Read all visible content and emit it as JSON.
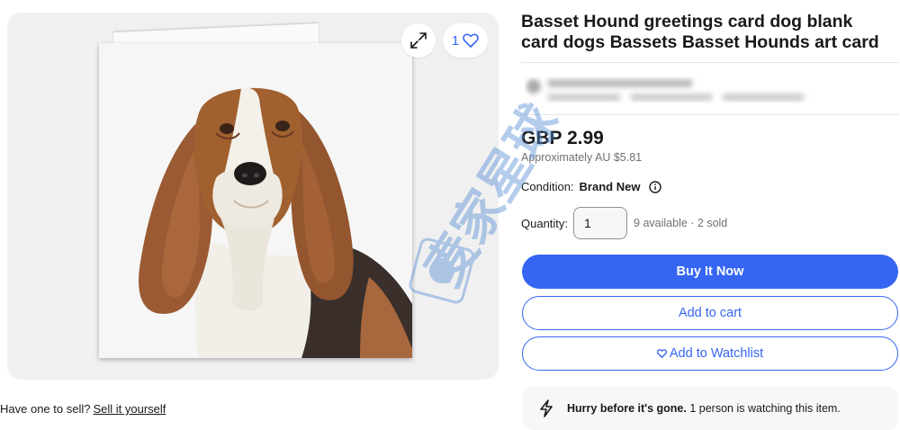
{
  "gallery": {
    "watch_count": "1",
    "icons": {
      "expand": "expand-icon",
      "heart": "heart-icon"
    }
  },
  "listing": {
    "title": "Basset Hound greetings card dog blank card dogs Bassets Basset Hounds art card",
    "price": "GBP 2.99",
    "approx_price": "Approximately AU $5.81",
    "condition_label": "Condition:",
    "condition_value": "Brand New",
    "quantity_label": "Quantity:",
    "quantity_value": "1",
    "availability": "9 available · 2 sold"
  },
  "actions": {
    "buy_now": "Buy It Now",
    "add_to_cart": "Add to cart",
    "add_to_watchlist": "Add to Watchlist"
  },
  "sell": {
    "prompt": "Have one to sell?",
    "link": "Sell it yourself"
  },
  "urgency": {
    "bold": "Hurry before it's gone.",
    "text": "1 person is watching this item."
  },
  "watermark_text": "麦家星球",
  "colors": {
    "accent": "#3665f3",
    "text": "#191919",
    "muted": "#707070",
    "gallery_bg": "#f0f0f0"
  }
}
